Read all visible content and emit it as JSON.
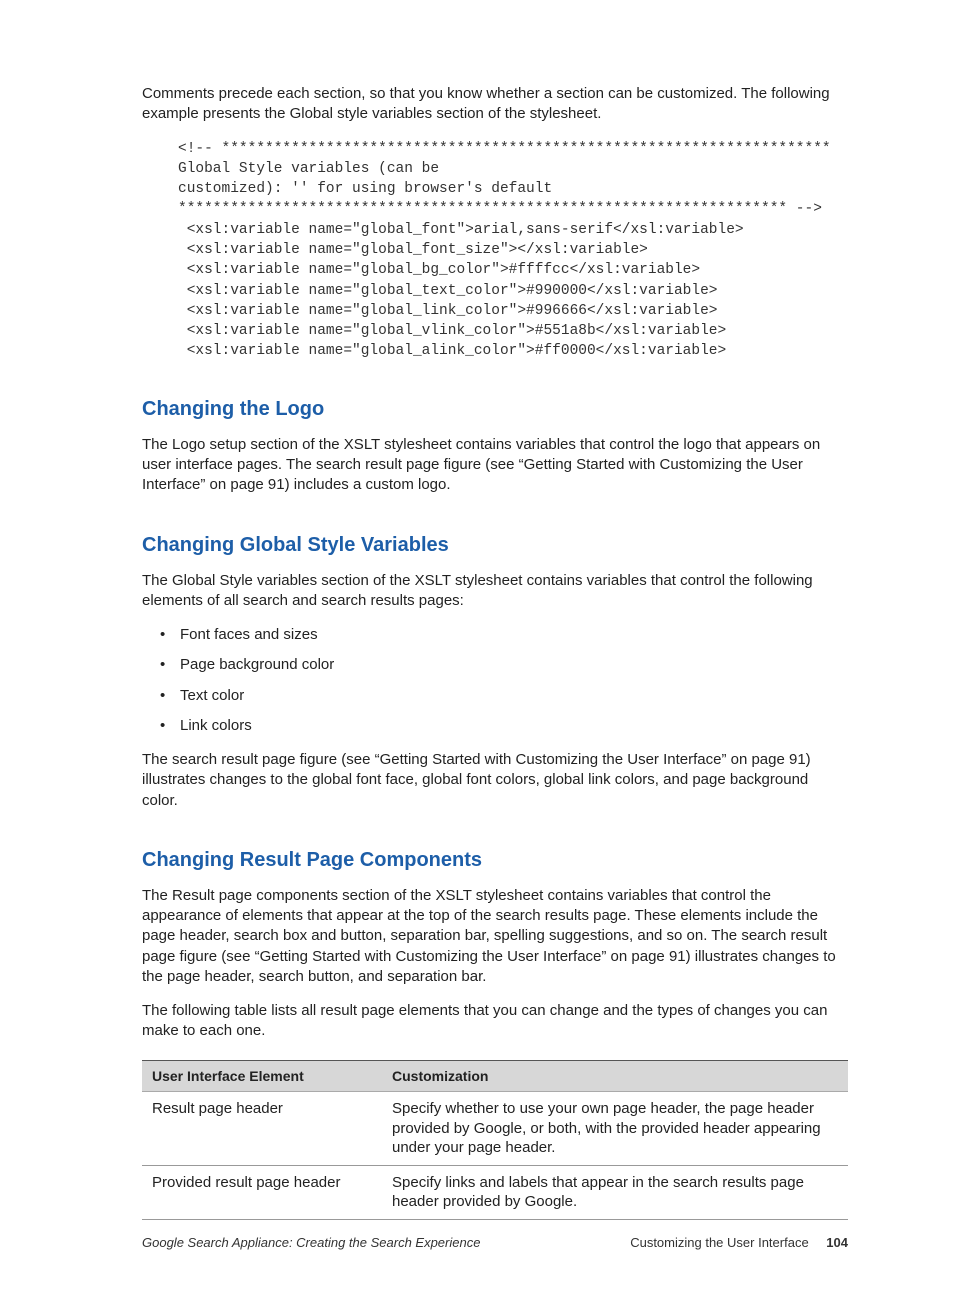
{
  "intro": "Comments precede each section, so that you know whether a section can be customized. The following example presents the Global style variables section of the stylesheet.",
  "code": "<!-- **********************************************************************\nGlobal Style variables (can be\ncustomized): '' for using browser's default\n********************************************************************** -->\n <xsl:variable name=\"global_font\">arial,sans-serif</xsl:variable>\n <xsl:variable name=\"global_font_size\"></xsl:variable>\n <xsl:variable name=\"global_bg_color\">#ffffcc</xsl:variable>\n <xsl:variable name=\"global_text_color\">#990000</xsl:variable>\n <xsl:variable name=\"global_link_color\">#996666</xsl:variable>\n <xsl:variable name=\"global_vlink_color\">#551a8b</xsl:variable>\n <xsl:variable name=\"global_alink_color\">#ff0000</xsl:variable>",
  "sec1": {
    "title": "Changing the Logo",
    "body": "The Logo setup section of the XSLT stylesheet contains variables that control the logo that appears on user interface pages. The search result page figure (see “Getting Started with Customizing the User Interface” on page 91) includes a custom logo."
  },
  "sec2": {
    "title": "Changing Global Style Variables",
    "body1": "The Global Style variables section of the XSLT stylesheet contains variables that control the following elements of all search and search results pages:",
    "items": [
      "Font faces and sizes",
      "Page background color",
      "Text color",
      "Link colors"
    ],
    "body2": "The search result page figure (see “Getting Started with Customizing the User Interface” on page 91) illustrates changes to the global font face, global font colors, global link colors, and page background color."
  },
  "sec3": {
    "title": "Changing Result Page Components",
    "body1": "The Result page components section of the XSLT stylesheet contains variables that control the appearance of elements that appear at the top of the search results page. These elements include the page header, search box and button, separation bar, spelling suggestions, and so on. The search result page figure (see “Getting Started with Customizing the User Interface” on page 91) illustrates changes to the page header, search button, and separation bar.",
    "body2": "The following table lists all result page elements that you can change and the types of changes you can make to each one."
  },
  "table": {
    "headers": [
      "User Interface Element",
      "Customization"
    ],
    "rows": [
      [
        "Result page header",
        "Specify whether to use your own page header, the page header provided by Google, or both, with the provided header appearing under your page header."
      ],
      [
        "Provided result page header",
        "Specify links and labels that appear in the search results page header provided by Google."
      ]
    ]
  },
  "footer": {
    "left": "Google Search Appliance: Creating the Search Experience",
    "right": "Customizing the User Interface",
    "page": "104"
  }
}
